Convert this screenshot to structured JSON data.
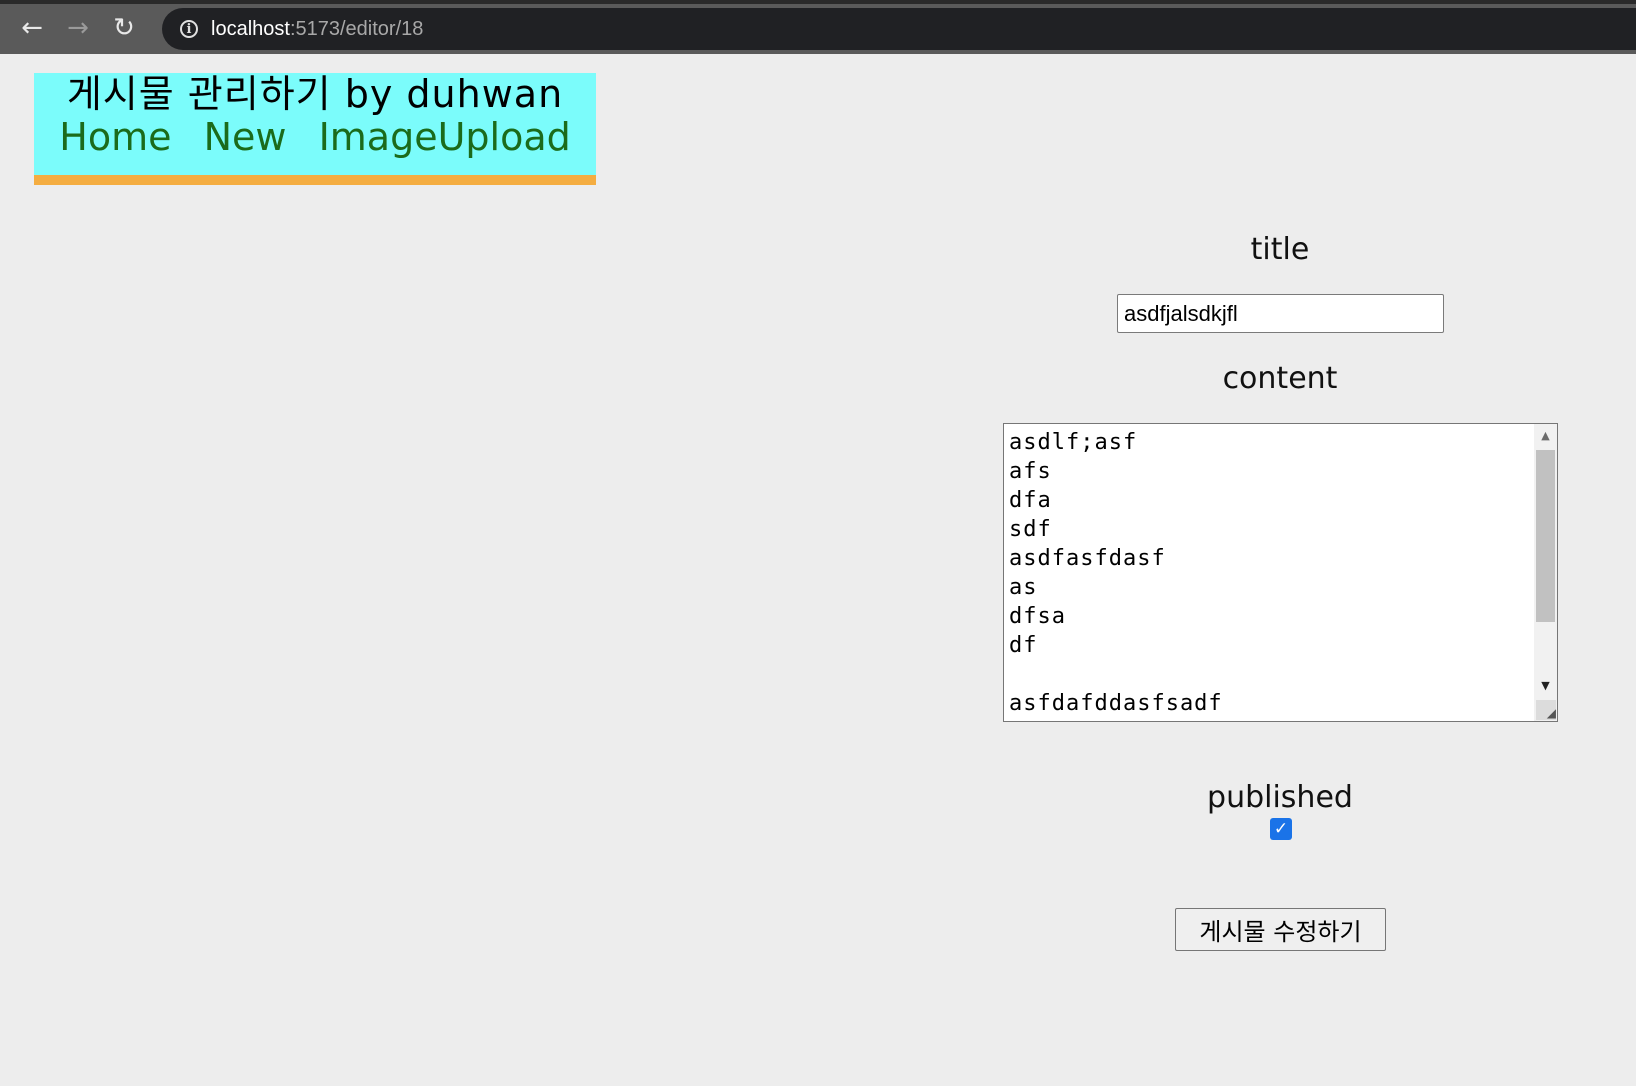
{
  "browser": {
    "back_icon": "←",
    "forward_icon": "→",
    "reload_icon": "↻",
    "info_icon": "i",
    "url_host": "localhost",
    "url_path": ":5173/editor/18"
  },
  "header": {
    "title": "게시물 관리하기 by duhwan",
    "nav": [
      "Home",
      "New",
      "ImageUpload"
    ],
    "bg_color": "#7bfcfb",
    "border_color": "#f4ad41",
    "link_color": "#1b6b1b"
  },
  "form": {
    "title_label": "title",
    "title_value": "asdfjalsdkjfl",
    "content_label": "content",
    "content_value": "asdlf;asf\nafs\ndfa\nsdf\nasdfasfdasf\nas\ndfsa\ndf\n\nasfdafddasfsadf",
    "published_label": "published",
    "published_checked": true,
    "checkmark": "✓",
    "submit_label": "게시물 수정하기"
  },
  "scrollbar": {
    "up_icon": "▲",
    "down_icon": "▼",
    "grip_icon": "◢"
  }
}
